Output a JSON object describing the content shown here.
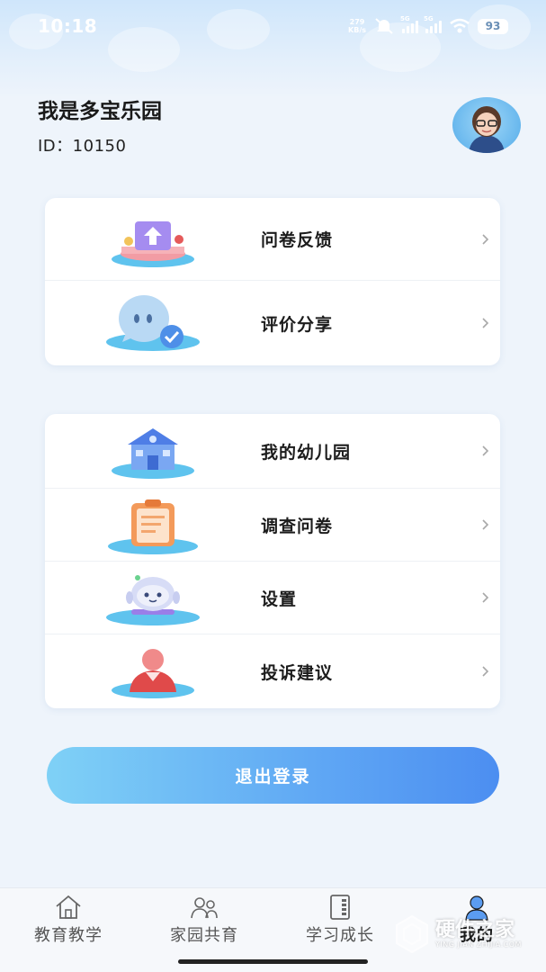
{
  "status_bar": {
    "time": "10:18",
    "net_speed_value": "279",
    "net_speed_unit": "KB/s",
    "signal1_label": "5G",
    "signal2_label": "5G",
    "battery": "93"
  },
  "profile": {
    "name": "我是多宝乐园",
    "id_text": "ID：10150"
  },
  "card1": {
    "items": [
      {
        "label": "问卷反馈",
        "icon": "upload-podium-icon"
      },
      {
        "label": "评价分享",
        "icon": "chat-check-icon"
      }
    ]
  },
  "card2": {
    "items": [
      {
        "label": "我的幼儿园",
        "icon": "school-building-icon"
      },
      {
        "label": "调查问卷",
        "icon": "clipboard-icon"
      },
      {
        "label": "设置",
        "icon": "robot-icon"
      },
      {
        "label": "投诉建议",
        "icon": "person-icon"
      }
    ]
  },
  "logout": {
    "label": "退出登录"
  },
  "tab_bar": {
    "tabs": [
      {
        "label": "教育教学",
        "icon": "house-icon"
      },
      {
        "label": "家园共育",
        "icon": "people-icon"
      },
      {
        "label": "学习成长",
        "icon": "book-icon"
      },
      {
        "label": "我的",
        "icon": "user-icon",
        "active": true
      }
    ]
  },
  "watermark": {
    "text": "硬件之家",
    "sub": "YING JIAN ZHIJIA.COM"
  },
  "colors": {
    "accent_start": "#7fd1f6",
    "accent_end": "#4c8ef1",
    "background": "#eef4fb"
  }
}
